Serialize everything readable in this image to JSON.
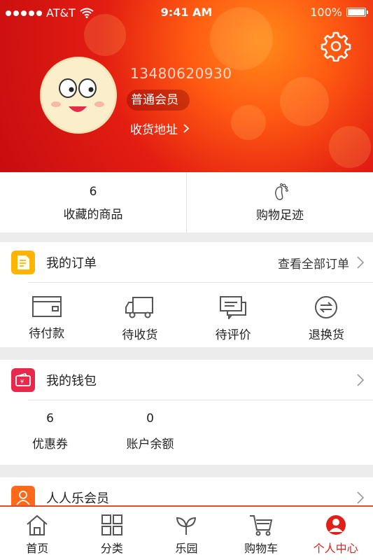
{
  "status_bar": {
    "carrier": "AT&T",
    "time": "9:41 AM",
    "battery": "100%"
  },
  "profile": {
    "phone": "13480620930",
    "member_level": "普通会员",
    "address_link": "收货地址"
  },
  "stats": {
    "favorites_count": "6",
    "favorites_label": "收藏的商品",
    "footprint_label": "购物足迹"
  },
  "orders": {
    "title": "我的订单",
    "view_all": "查看全部订单",
    "items": [
      {
        "label": "待付款",
        "icon": "wallet-icon"
      },
      {
        "label": "待收货",
        "icon": "truck-icon"
      },
      {
        "label": "待评价",
        "icon": "comment-icon"
      },
      {
        "label": "退换货",
        "icon": "exchange-icon"
      }
    ]
  },
  "wallet": {
    "title": "我的钱包",
    "coupons_count": "6",
    "coupons_label": "优惠券",
    "balance_count": "0",
    "balance_label": "账户余额"
  },
  "membership": {
    "title": "人人乐会员"
  },
  "tabbar": {
    "items": [
      {
        "label": "首页",
        "icon": "home-icon"
      },
      {
        "label": "分类",
        "icon": "grid-icon"
      },
      {
        "label": "乐园",
        "icon": "sprout-icon"
      },
      {
        "label": "购物车",
        "icon": "cart-icon"
      },
      {
        "label": "个人中心",
        "icon": "user-icon"
      }
    ],
    "active_index": 4
  },
  "colors": {
    "accent": "#e0211a",
    "orders_icon": "#ffb400",
    "wallet_icon": "#e8294c",
    "membership_icon": "#ff6a1a"
  }
}
